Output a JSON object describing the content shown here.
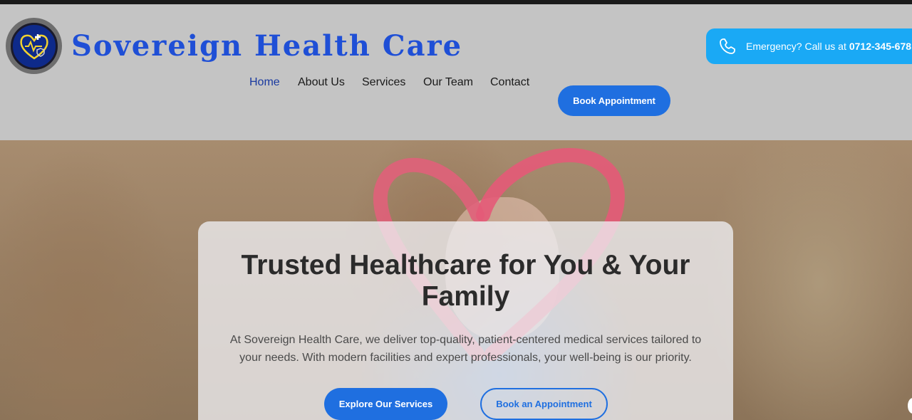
{
  "header": {
    "brand_name": "Sovereign Health Care",
    "nav": [
      {
        "label": "Home",
        "active": true
      },
      {
        "label": "About Us",
        "active": false
      },
      {
        "label": "Services",
        "active": false
      },
      {
        "label": "Our Team",
        "active": false
      },
      {
        "label": "Contact",
        "active": false
      }
    ],
    "book_button": "Book Appointment",
    "emergency": {
      "label": "Emergency? Call us at",
      "phone": "0712-345-678",
      "icon": "phone-icon"
    }
  },
  "hero": {
    "title": "Trusted Healthcare for You & Your Family",
    "text": "At Sovereign Health Care, we deliver top-quality, patient-centered medical services tailored to your needs. With modern facilities and expert professionals, your well-being is our priority.",
    "primary_button": "Explore Our Services",
    "secondary_button": "Book an Appointment"
  },
  "colors": {
    "brand": "#1f4fd6",
    "accent": "#1f6fe0",
    "emergency": "#1aa9f5",
    "header_bg": "#c4c4c4"
  }
}
